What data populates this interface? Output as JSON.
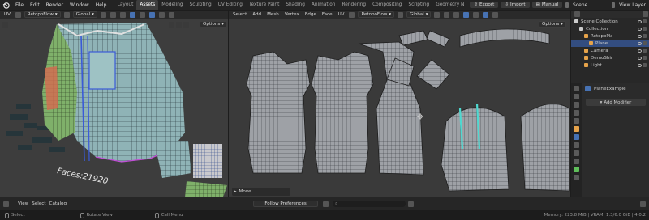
{
  "app": {
    "menu": [
      "File",
      "Edit",
      "Render",
      "Window",
      "Help"
    ],
    "workspaces": [
      "Layout",
      "Assets",
      "Modeling",
      "Sculpting",
      "UV Editing",
      "Texture Paint",
      "Shading",
      "Animation",
      "Rendering",
      "Compositing",
      "Scripting",
      "Geometry N"
    ],
    "active_workspace": "Assets",
    "buttons": {
      "export": "Export",
      "import": "Import",
      "manual": "Manual"
    },
    "scene": "Scene",
    "view_layer": "View Layer"
  },
  "uv_editor": {
    "editor": "UV",
    "mode": "RetopoFlow",
    "transform": "Global",
    "menu": [
      "Select",
      "Add",
      "Mesh",
      "Vertex",
      "Edge",
      "Face",
      "UV"
    ],
    "options": "Options",
    "operator_panel": "Move"
  },
  "viewport": {
    "editor": "UV",
    "mode": "RetopoFlow",
    "transform": "Global",
    "options": "Options",
    "overlay_text": "Faces:21920"
  },
  "outliner": {
    "items": [
      {
        "label": "Scene Collection",
        "depth": 0,
        "color": "#cccccc"
      },
      {
        "label": "Collection",
        "depth": 1,
        "color": "#cccccc"
      },
      {
        "label": "RetopoPla",
        "depth": 2,
        "color": "#e6a34a"
      },
      {
        "label": "Plane",
        "depth": 3,
        "color": "#e6a34a",
        "selected": true
      },
      {
        "label": "Camera",
        "depth": 2,
        "color": "#e6a34a"
      },
      {
        "label": "DemoShir",
        "depth": 2,
        "color": "#e6a34a"
      },
      {
        "label": "Light",
        "depth": 2,
        "color": "#e6a34a"
      }
    ]
  },
  "properties": {
    "object_name": "PlaneExample",
    "add_modifier": "Add Modifier"
  },
  "bottom_bar": {
    "menu": [
      "View",
      "Select",
      "Catalog"
    ],
    "follow": "Follow Preferences"
  },
  "statusbar": {
    "select": "Select",
    "rotate": "Rotate View",
    "call_menu": "Call Menu",
    "memory": "Memory: 223.8 MiB | VRAM: 1.3/6.0 GiB | 4.0.2"
  },
  "colors": {
    "selected_row": "#334d80",
    "accent": "#4772b3",
    "object_orange": "#e6a34a"
  }
}
